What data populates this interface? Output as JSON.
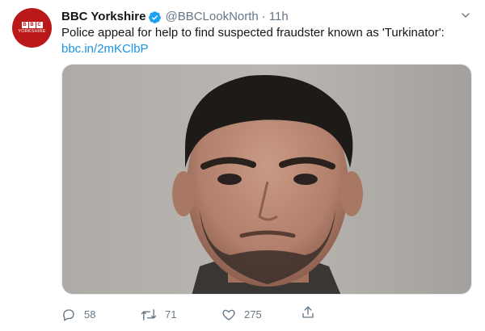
{
  "account": {
    "name": "BBC Yorkshire",
    "handle": "@BBCLookNorth",
    "separator": "·",
    "time": "11h",
    "avatar_logo_letters": [
      "B",
      "B",
      "C"
    ],
    "avatar_logo_sub": "YORKSHIRE"
  },
  "tweet": {
    "text": "Police appeal for help to find suspected fraudster known as 'Turkinator':",
    "link": "bbc.in/2mKClbP"
  },
  "actions": {
    "replies": "58",
    "retweets": "71",
    "likes": "275"
  },
  "colors": {
    "brand_red": "#bb1919",
    "link_blue": "#1b95e0",
    "muted_gray": "#657786"
  },
  "icons": [
    "verified-badge-icon",
    "chevron-down-icon",
    "reply-icon",
    "retweet-icon",
    "like-icon",
    "share-icon"
  ]
}
